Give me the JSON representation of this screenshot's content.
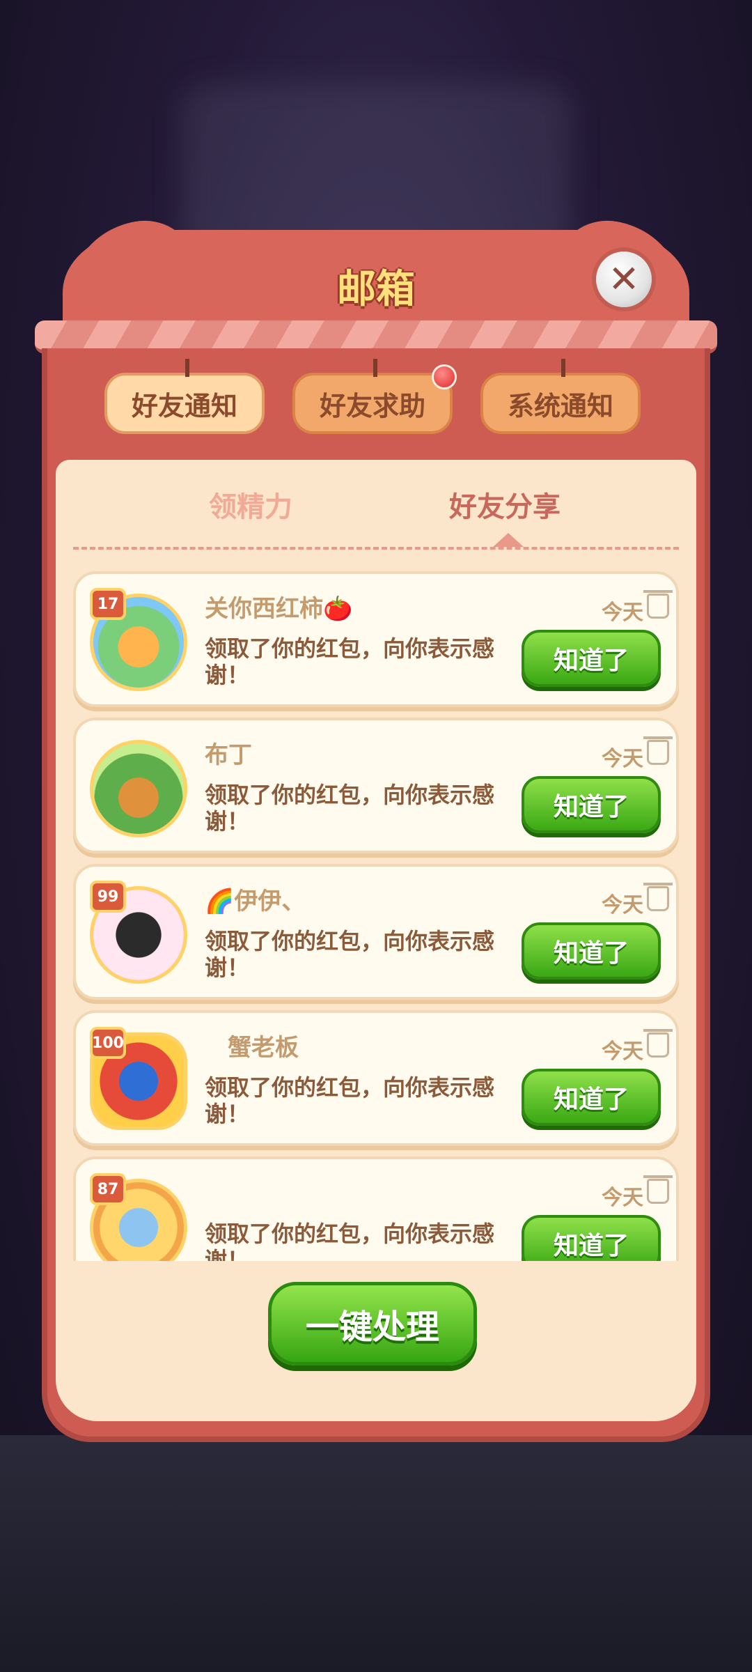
{
  "dialog": {
    "title": "邮箱",
    "close_glyph": "✕"
  },
  "tabs": [
    {
      "label": "好友通知"
    },
    {
      "label": "好友求助",
      "has_badge": true
    },
    {
      "label": "系统通知"
    }
  ],
  "subtabs": [
    {
      "label": "领精力"
    },
    {
      "label": "好友分享",
      "active": true
    }
  ],
  "messages": [
    {
      "level": "17",
      "name": "关你西红柿🍅",
      "text": "领取了你的红包，向你表示感谢！",
      "date": "今天",
      "button": "知道了",
      "avatar_icon": "dragon-avatar-icon"
    },
    {
      "level": "",
      "name": "布丁",
      "text": "领取了你的红包，向你表示感谢！",
      "date": "今天",
      "button": "知道了",
      "avatar_icon": "bear-avatar-icon"
    },
    {
      "level": "99",
      "name": "🌈伊伊、",
      "text": "领取了你的红包，向你表示感谢！",
      "date": "今天",
      "button": "知道了",
      "avatar_icon": "girl-photo-avatar"
    },
    {
      "level": "100",
      "name": "蟹老板",
      "text": "领取了你的红包，向你表示感谢！",
      "date": "今天",
      "button": "知道了",
      "avatar_icon": "crab-avatar-icon"
    },
    {
      "level": "87",
      "name": "",
      "text": "领取了你的红包，向你表示感谢！",
      "date": "今天",
      "button": "知道了",
      "avatar_icon": "anime-avatar-icon"
    }
  ],
  "footer": {
    "process_all_label": "一键处理"
  }
}
